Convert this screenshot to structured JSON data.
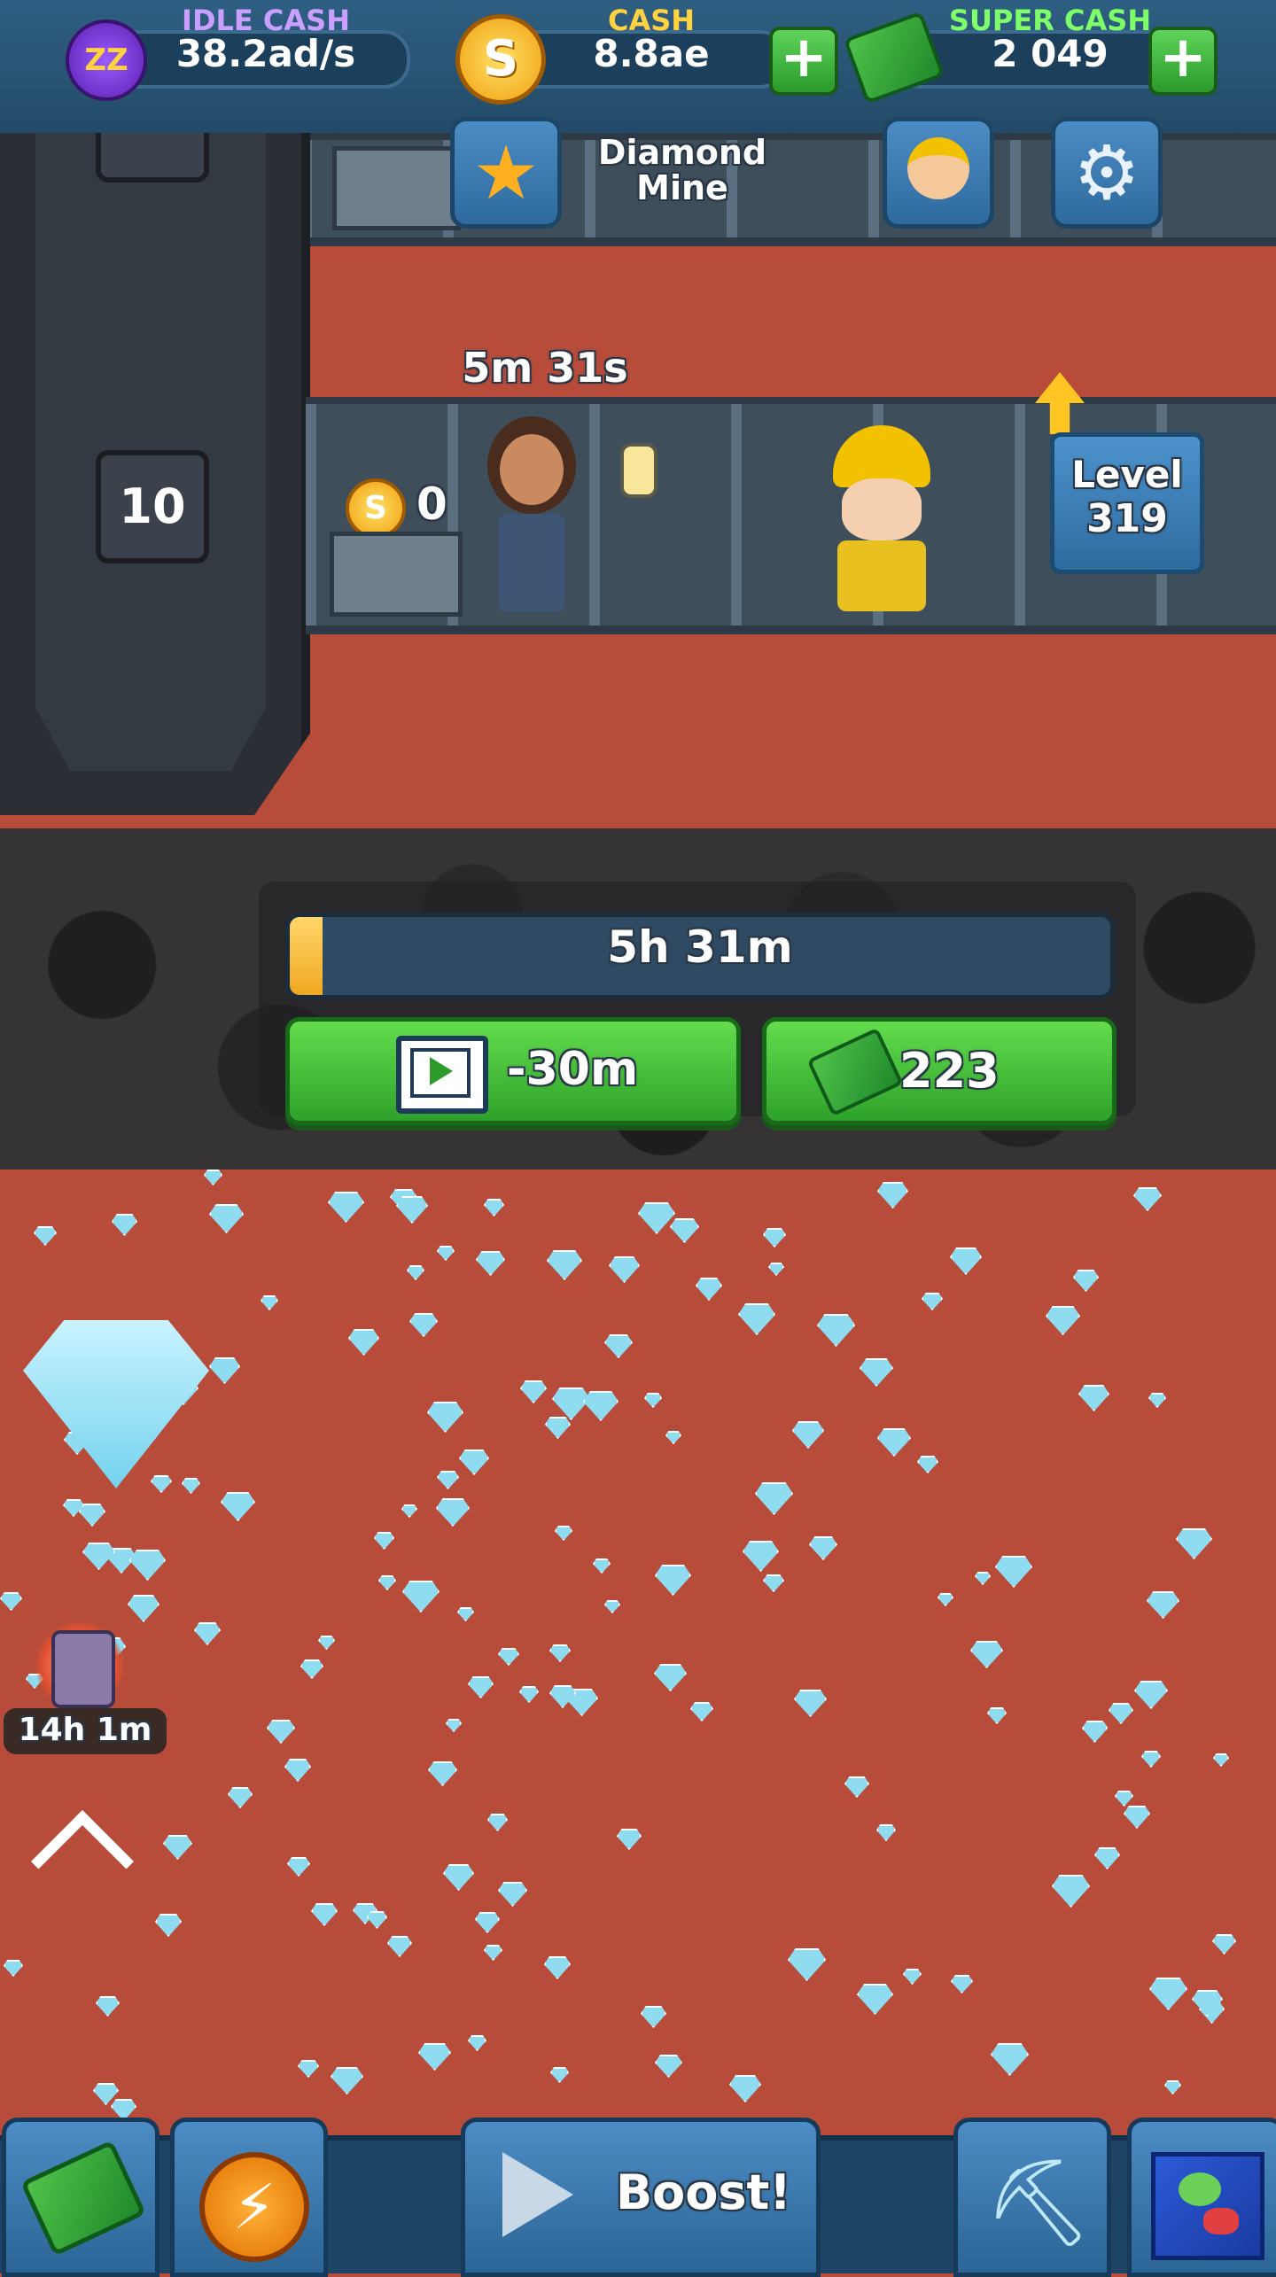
{
  "top_bar": {
    "idle_cash": {
      "title": "IDLE CASH",
      "value": "38.2ad/s",
      "title_color": "#c9a0ff"
    },
    "cash": {
      "title": "CASH",
      "value": "8.8ae",
      "title_color": "#ffd23f"
    },
    "super_cash": {
      "title": "SUPER CASH",
      "value": "2 049",
      "title_color": "#7dff6a"
    },
    "plus_label": "+"
  },
  "header": {
    "mine_name_line1": "Diamond",
    "mine_name_line2": "Mine"
  },
  "shaft": {
    "timer": "5m 31s",
    "coin_count": "0",
    "floor_number": "10",
    "level_label": "Level",
    "level_value": "319"
  },
  "unlock": {
    "time_remaining": "5h 31m",
    "progress_percent": 4,
    "ad_button_label": "-30m",
    "cash_button_value": "223"
  },
  "side": {
    "boost_timer": "14h 1m"
  },
  "bottom_bar": {
    "boost_label": "Boost!"
  },
  "colors": {
    "ground": "#b84c3a",
    "accent_green": "#3db83a",
    "panel_blue": "#2e6a9e"
  }
}
